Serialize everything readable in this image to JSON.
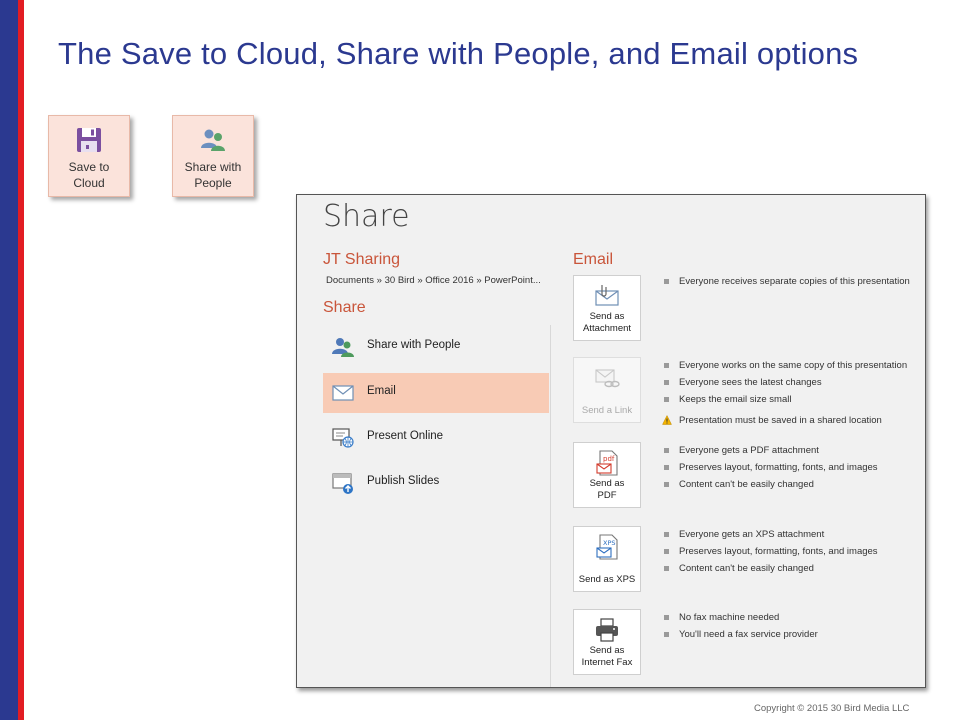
{
  "slide": {
    "title": "The Save to Cloud, Share with People, and Email options",
    "copyright": "Copyright © 2015 30 Bird Media LLC"
  },
  "tiles": [
    {
      "label": "Save to\nCloud",
      "icon": "floppy-disk-icon"
    },
    {
      "label": "Share with\nPeople",
      "icon": "people-icon"
    }
  ],
  "share_panel": {
    "title": "Share",
    "document_name": "JT Sharing",
    "path": "Documents » 30 Bird » Office 2016 » PowerPoint...",
    "section_heading": "Share",
    "menu": [
      {
        "label": "Share with People",
        "icon": "people-icon",
        "active": false
      },
      {
        "label": "Email",
        "icon": "envelope-icon",
        "active": true
      },
      {
        "label": "Present Online",
        "icon": "present-online-icon",
        "active": false
      },
      {
        "label": "Publish Slides",
        "icon": "publish-slides-icon",
        "active": false
      }
    ],
    "email": {
      "heading": "Email",
      "options": [
        {
          "label": "Send as\nAttachment",
          "icon": "attachment-icon",
          "enabled": true,
          "bullets": [
            "Everyone receives separate copies of this presentation"
          ]
        },
        {
          "label": "Send a Link",
          "icon": "link-icon",
          "enabled": false,
          "bullets": [
            "Everyone works on the same copy of this presentation",
            "Everyone sees the latest changes",
            "Keeps the email size small"
          ],
          "warning": "Presentation must be saved in a shared location"
        },
        {
          "label": "Send as\nPDF",
          "icon": "pdf-icon",
          "enabled": true,
          "bullets": [
            "Everyone gets a PDF attachment",
            "Preserves layout, formatting, fonts, and images",
            "Content can't be easily changed"
          ]
        },
        {
          "label": "Send as XPS",
          "icon": "xps-icon",
          "enabled": true,
          "bullets": [
            "Everyone gets an XPS attachment",
            "Preserves layout, formatting, fonts, and images",
            "Content can't be easily changed"
          ]
        },
        {
          "label": "Send as\nInternet Fax",
          "icon": "fax-icon",
          "enabled": true,
          "bullets": [
            "No fax machine needed",
            "You'll need a fax service provider"
          ]
        }
      ]
    }
  },
  "colors": {
    "title_blue": "#2b3990",
    "accent_red": "#e21c23",
    "heading_orange": "#c9553a",
    "active_item": "#f8cbb5",
    "tile_bg": "#fbe3db"
  }
}
